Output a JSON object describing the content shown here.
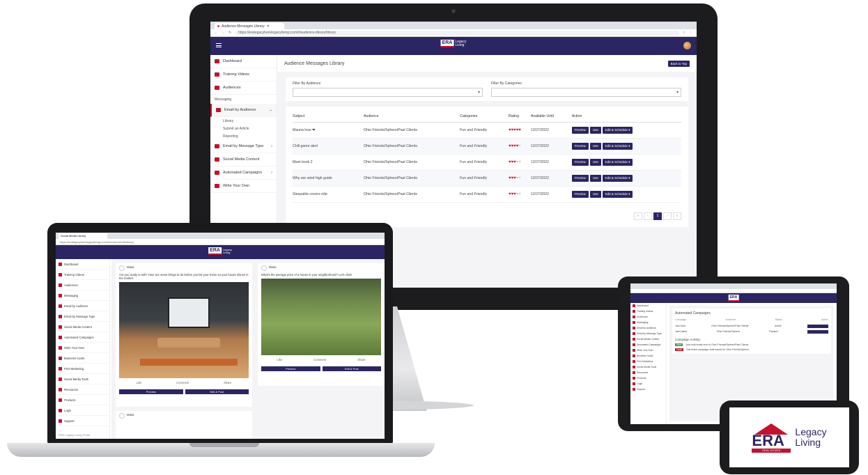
{
  "brand": {
    "name_short": "ERA",
    "name_long_1": "Legacy",
    "name_long_2": "Living",
    "subtitle": "REAL ESTATE",
    "primary_color": "#2b2563",
    "accent_color": "#c8102e"
  },
  "desktop": {
    "tab_title": "Audience Messages Library",
    "url": "https://erategacyherelegacyliving.com/#/audience-library/library",
    "page_title": "Audience Messages Library",
    "header_button": "Back to Top",
    "sidebar": {
      "items": [
        {
          "label": "Dashboard",
          "icon": "dashboard-icon"
        },
        {
          "label": "Training Videos",
          "icon": "video-icon"
        },
        {
          "label": "Audiences",
          "icon": "people-icon"
        }
      ],
      "section_messaging": "Messaging",
      "active_item": "Email by Audience",
      "sub_items": [
        "Library",
        "Submit an Article",
        "Reporting"
      ],
      "items_after": [
        {
          "label": "Email by Message Type",
          "icon": "email-icon"
        },
        {
          "label": "Social Media Content",
          "icon": "share-icon"
        },
        {
          "label": "Automated Campaigns",
          "icon": "campaign-icon"
        },
        {
          "label": "Write Your Own",
          "icon": "pen-icon"
        }
      ]
    },
    "filters": {
      "audience_label": "Filter By Audience",
      "category_label": "Filter By Categories"
    },
    "table": {
      "headers": [
        "Subject",
        "Audience",
        "Categories",
        "Rating",
        "Available Until",
        "Action"
      ],
      "rows": [
        {
          "subject": "Mauna love ❤",
          "audience": "Ohio Friends/Sphere/Past Clients",
          "category": "Fun and Friendly",
          "rating": 5,
          "date": "12/27/2022"
        },
        {
          "subject": "Chill game alert",
          "audience": "Ohio Friends/Sphere/Past Clients",
          "category": "Fun and Friendly",
          "rating": 4,
          "date": "12/27/2022"
        },
        {
          "subject": "Meet book 2",
          "audience": "Ohio Friends/Sphere/Past Clients",
          "category": "Fun and Friendly",
          "rating": 3,
          "date": "12/27/2022"
        },
        {
          "subject": "Why are wind high guide",
          "audience": "Ohio Friends/Sphere/Past Clients",
          "category": "Fun and Friendly",
          "rating": 3,
          "date": "12/27/2022"
        },
        {
          "subject": "Sleepable covers ride",
          "audience": "Ohio Friends/Sphere/Past Clients",
          "category": "Fun and Friendly",
          "rating": 3,
          "date": "12/27/2022"
        }
      ],
      "action_preview": "Preview",
      "action_use": "Use",
      "action_edit": "Edit & Schedule ▾"
    },
    "pagination": {
      "prev2": "«",
      "prev": "‹",
      "current": "1",
      "next": "›",
      "next2": "»"
    }
  },
  "laptop": {
    "tab_title": "Social Media Library",
    "url": "https://erategacyherelegacyliving.com/#/social-media/library",
    "sidebar": [
      "Dashboard",
      "Training Videos",
      "Audiences",
      "Messaging",
      "Email by Audience",
      "Email by Message Type",
      "Social Media Content",
      "Automated Campaigns",
      "Write Your Own",
      "Business Cards",
      "Print Marketing",
      "Social Media Tools",
      "Resources",
      "Products",
      "Login",
      "Support"
    ],
    "post1": {
      "author": "Maria",
      "text": "Are you ready to sell? Here are some things to do before you list your home so your house shines in the market.",
      "like": "Like",
      "comment": "Comment",
      "share": "Share",
      "btn1": "Preview",
      "btn2": "Edit & Post"
    },
    "post2": {
      "author": "Maria",
      "text": "What's the average price of a house in your neighborhood? Let's chat!",
      "like": "Like",
      "comment": "Comment",
      "share": "Share",
      "btn1": "Preview",
      "btn2": "Edit & Post"
    },
    "post3": {
      "author": "Maria"
    },
    "footer": "ERA Legacy Living Portal"
  },
  "tablet": {
    "page_title": "Automated Campaigns",
    "headers": [
      "Campaign",
      "Audience",
      "Status",
      "Action"
    ],
    "rows": [
      {
        "name": "Just Sold",
        "audience": "Ohio Friends/Sphere/Past Clients",
        "status": "Active"
      },
      {
        "name": "Just Listed",
        "audience": "Ohio Friends/Sphere",
        "status": "Paused"
      }
    ],
    "section": "Campaign Activity",
    "activity": [
      {
        "badge": "Sent",
        "text": "Just sold email sent to Ohio Friends/Sphere/Past Clients"
      },
      {
        "badge": "Draft",
        "text": "Just listed campaign draft saved for Ohio Friends/Sphere"
      }
    ]
  }
}
